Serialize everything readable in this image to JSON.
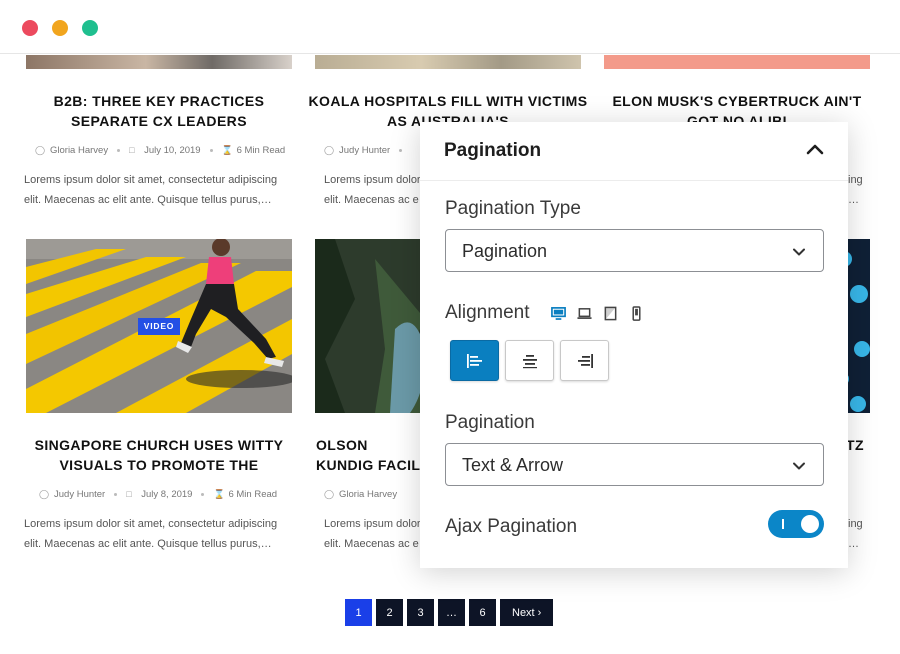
{
  "window": {
    "controls": [
      "close",
      "minimize",
      "maximize"
    ]
  },
  "posts_row1": [
    {
      "title": "B2B: THREE KEY PRACTICES SEPARATE CX LEADERS",
      "author": "Gloria Harvey",
      "date": "July 10, 2019",
      "read": "6 Min Read",
      "excerpt": "Lorems ipsum dolor sit amet, consectetur adipiscing elit. Maecenas ac elit ante. Quisque tellus purus,…"
    },
    {
      "title": "KOALA HOSPITALS FILL WITH VICTIMS AS AUSTRALIA'S",
      "author": "Judy Hunter",
      "excerpt": "Lorems ipsum dolor elit. Maecenas ac e"
    },
    {
      "title": "ELON MUSK'S CYBERTRUCK AIN'T GOT NO ALIBI",
      "excerpt_tail_1": "ing",
      "excerpt_tail_2": "…"
    }
  ],
  "posts_row2": [
    {
      "title": "SINGAPORE CHURCH USES WITTY VISUALS TO PROMOTE THE",
      "author": "Judy Hunter",
      "date": "July 8, 2019",
      "read": "6 Min Read",
      "badge": "VIDEO",
      "excerpt": "Lorems ipsum dolor sit amet, consectetur adipiscing elit. Maecenas ac elit ante. Quisque tellus purus,…"
    },
    {
      "title": "OLSON KUNDIG FACILI",
      "author": "Gloria Harvey",
      "excerpt": "Lorems ipsum dolor elit. Maecenas ac e"
    },
    {
      "title_tail": "TZ",
      "excerpt_tail_1": "ing",
      "excerpt_tail_2": "…"
    }
  ],
  "pager": {
    "pages": [
      "1",
      "2",
      "3",
      "…",
      "6"
    ],
    "active": "1",
    "next": "Next ›"
  },
  "panel": {
    "title": "Pagination",
    "type_label": "Pagination Type",
    "type_value": "Pagination",
    "alignment_label": "Alignment",
    "devices": [
      "desktop-icon",
      "laptop-icon",
      "tablet-icon",
      "mobile-icon"
    ],
    "alignment_selected": "left",
    "pagination_label": "Pagination",
    "pagination_value": "Text & Arrow",
    "ajax_label": "Ajax Pagination",
    "ajax_enabled": true
  },
  "colors": {
    "accent": "#0a7fc0",
    "pager_active": "#1a3fe8",
    "pager_bg": "#0d1426",
    "badge": "#2450e5"
  }
}
